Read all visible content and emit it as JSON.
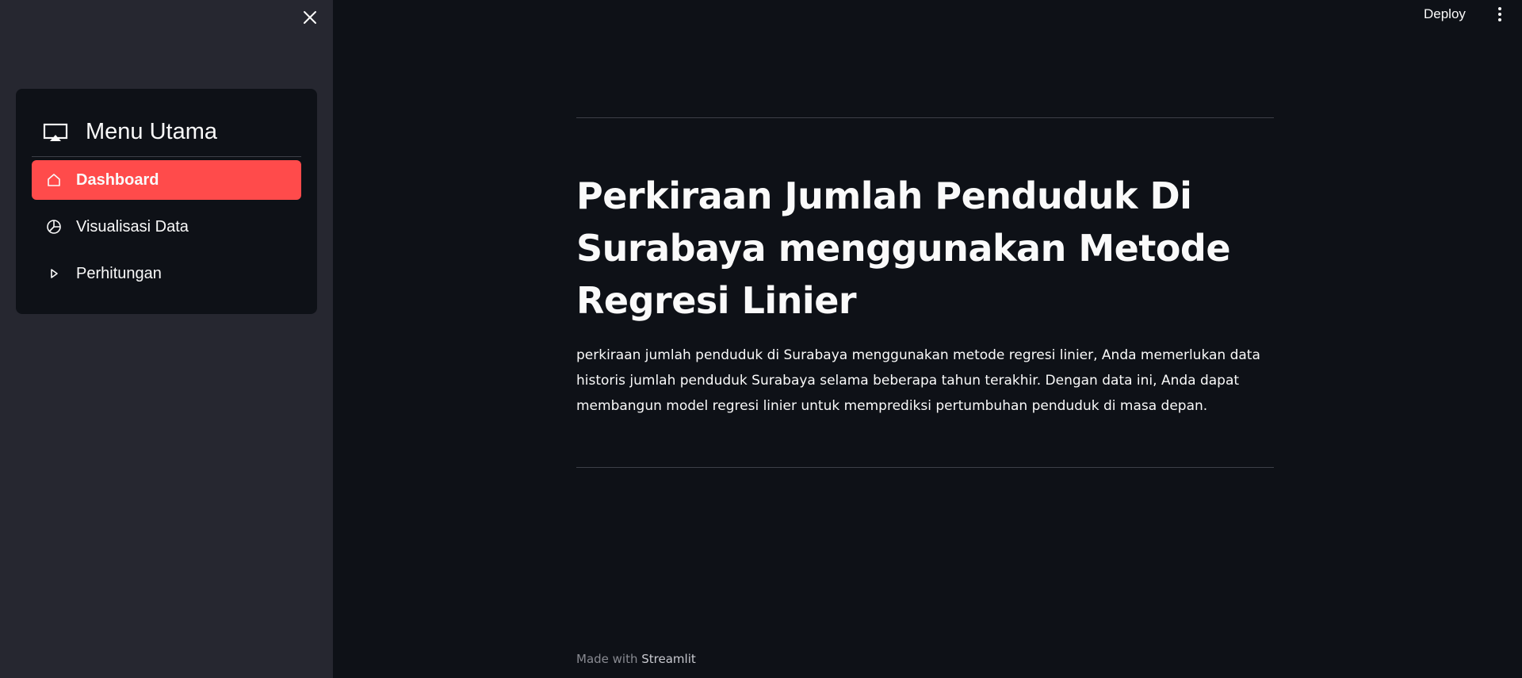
{
  "sidebar": {
    "close_icon": "close-icon",
    "menu": {
      "title": "Menu Utama",
      "icon": "airplay-icon",
      "items": [
        {
          "label": "Dashboard",
          "icon": "home-icon",
          "active": true
        },
        {
          "label": "Visualisasi Data",
          "icon": "pie-chart-icon",
          "active": false
        },
        {
          "label": "Perhitungan",
          "icon": "play-icon",
          "active": false
        }
      ]
    }
  },
  "header": {
    "deploy_label": "Deploy",
    "more_icon": "more-vertical-icon"
  },
  "main": {
    "title": "Perkiraan Jumlah Penduduk Di Surabaya menggunakan Metode Regresi Linier",
    "description": "perkiraan jumlah penduduk di Surabaya menggunakan metode regresi linier, Anda memerlukan data historis jumlah penduduk Surabaya selama beberapa tahun terakhir. Dengan data ini, Anda dapat membangun model regresi linier untuk memprediksi pertumbuhan penduduk di masa depan."
  },
  "footer": {
    "prefix": "Made with",
    "brand": "Streamlit"
  },
  "colors": {
    "background": "#0e1117",
    "sidebar": "#262730",
    "accent": "#ff4b4b",
    "text": "#fafafa"
  }
}
